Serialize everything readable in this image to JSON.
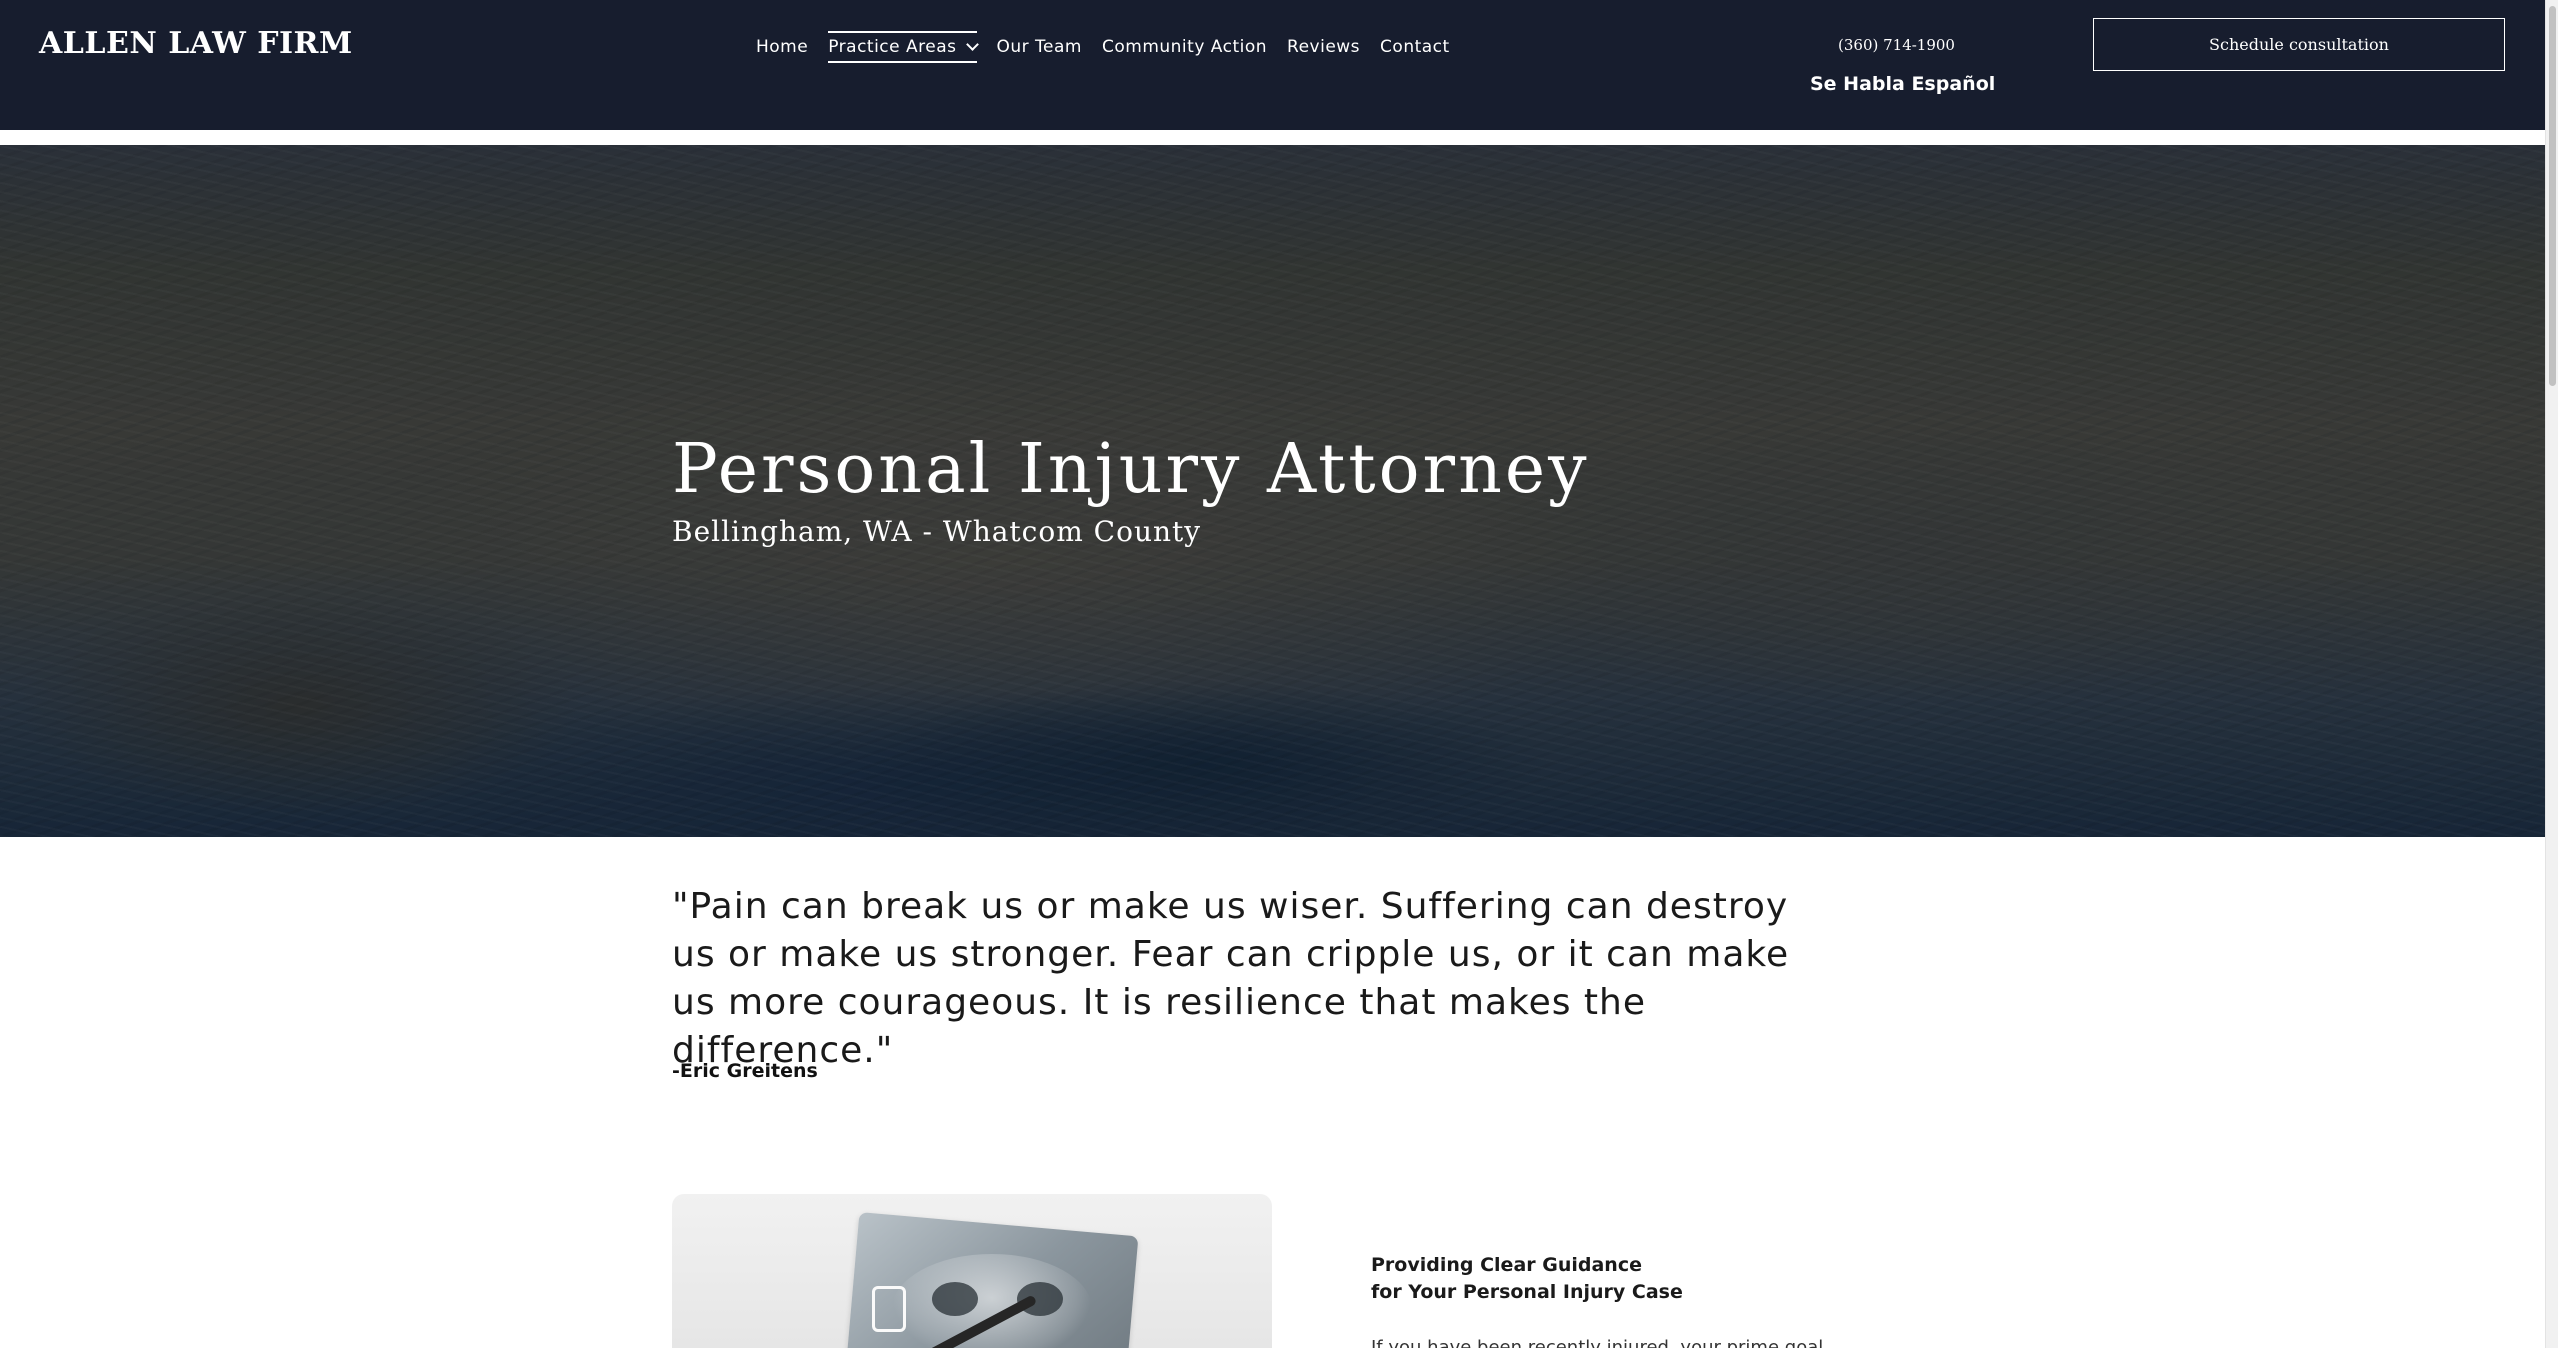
{
  "header": {
    "logo": "ALLEN LAW FIRM",
    "nav": {
      "home": "Home",
      "practice_areas": "Practice Areas",
      "our_team": "Our Team",
      "community_action": "Community Action",
      "reviews": "Reviews",
      "contact": "Contact"
    },
    "phone": "(360) 714-1900",
    "language_note": "Se Habla Español",
    "cta_label": "Schedule consultation"
  },
  "hero": {
    "title": "Personal Injury Attorney",
    "subtitle": "Bellingham, WA - Whatcom County"
  },
  "quote": {
    "text": "\"Pain can break us or make us wiser. Suffering can destroy us or make us stronger. Fear can cripple us, or it can make us more courageous. It is resilience that makes the difference.\"",
    "author": "-Eric Greitens"
  },
  "guidance": {
    "heading_line1": "Providing Clear Guidance",
    "heading_line2": "for Your Personal Injury Case",
    "text": "If you have been recently injured, your prime goal"
  },
  "colors": {
    "header_bg": "#171d2e",
    "text_dark": "#1a1a1a"
  }
}
